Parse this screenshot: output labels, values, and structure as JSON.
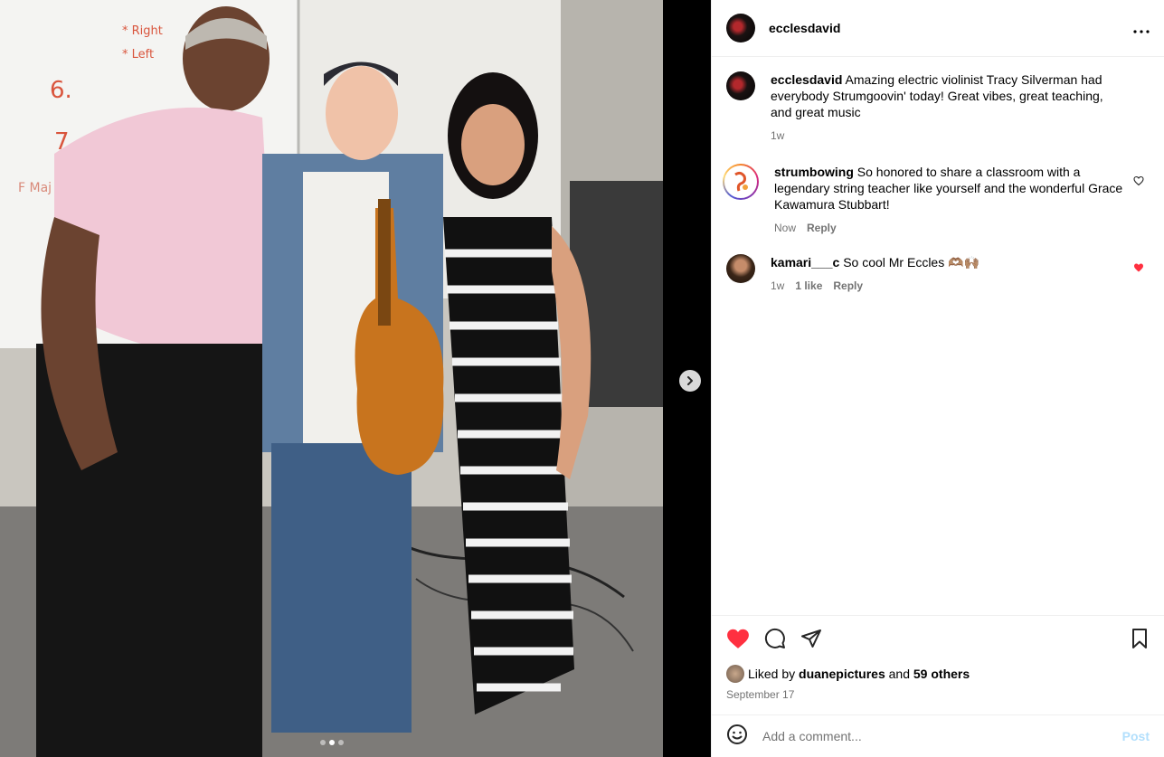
{
  "post": {
    "username": "ecclesdavid",
    "more_icon": "more-horizontal-icon",
    "next_icon": "chevron-right-icon",
    "carousel": {
      "count": 3,
      "active": 1
    }
  },
  "comments": [
    {
      "username": "ecclesdavid",
      "text": "Amazing electric violinist Tracy Silverman had everybody Strumgoovin' today! Great vibes, great teaching, and great music",
      "time": "1w"
    },
    {
      "username": "strumbowing",
      "text": "So honored to share a classroom with a legendary string teacher like yourself and the wonderful Grace Kawamura Stubbart!",
      "time": "Now",
      "reply": "Reply",
      "liked": false
    },
    {
      "username": "kamari___c",
      "text": "So cool Mr Eccles 🫶🏽🙌🏽",
      "time": "1w",
      "likes": "1 like",
      "reply": "Reply",
      "liked": true
    }
  ],
  "actions": {
    "liked": true,
    "like_color": "#ff3040",
    "liked_by_prefix": "Liked by",
    "liked_by_user": "duanepictures",
    "liked_by_mid": "and",
    "liked_by_others": "59 others",
    "date": "September 17"
  },
  "comment_box": {
    "placeholder": "Add a comment...",
    "post_label": "Post"
  }
}
